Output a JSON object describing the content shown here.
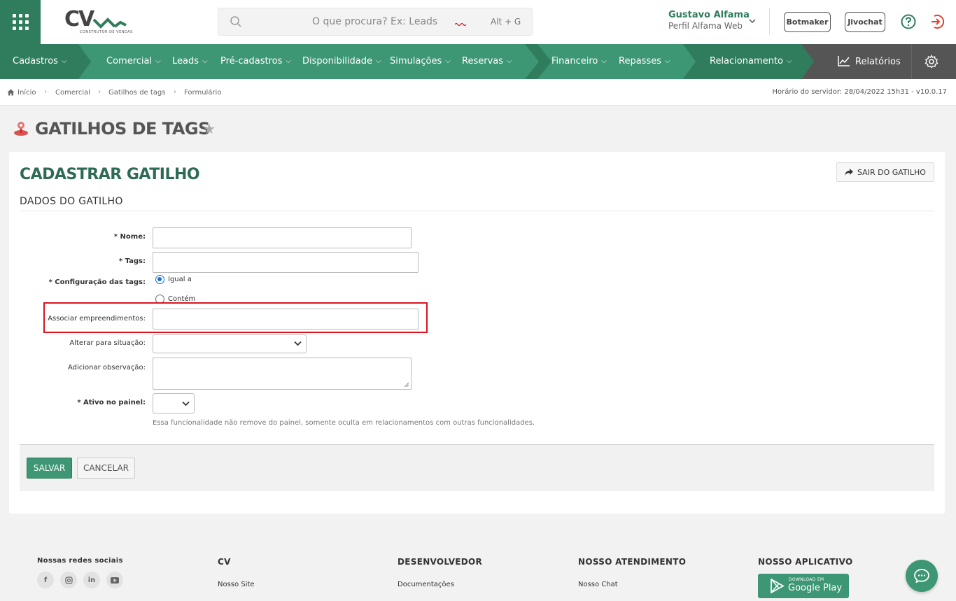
{
  "header": {
    "search_placeholder": "O que procura? Ex: Leads",
    "search_shortcut": "Alt + G",
    "user_name": "Gustavo Alfama",
    "user_profile": "Perfil Alfama Web",
    "botmaker_label": "Botmaker",
    "jivochat_label": "Jivochat",
    "logo_text": "CV",
    "logo_sub": "CONSTRUTOR DE VENDAS"
  },
  "nav": {
    "items": [
      "Cadastros",
      "Comercial",
      "Leads",
      "Pré-cadastros",
      "Disponibilidade",
      "Simulações",
      "Reservas",
      "Financeiro",
      "Repasses",
      "Relacionamento"
    ],
    "reports_label": "Relatórios"
  },
  "breadcrumb": {
    "items": [
      "Início",
      "Comercial",
      "Gatilhos de tags",
      "Formulário"
    ],
    "server_time": "Horário do servidor: 28/04/2022 15h31 - v10.0.17"
  },
  "page": {
    "title": "GATILHOS DE TAGS"
  },
  "form": {
    "title": "CADASTRAR GATILHO",
    "exit_label": "SAIR DO GATILHO",
    "section_title": "DADOS DO GATILHO",
    "name_label": "* Nome:",
    "tags_label": "* Tags:",
    "tags_config_label": "* Configuração das tags:",
    "radio_equal": "Igual a",
    "radio_contains": "Contém",
    "enterprises_label": "Associar empreendimentos:",
    "change_status_label": "Alterar para situação:",
    "observation_label": "Adicionar observação:",
    "active_label": "* Ativo no painel:",
    "active_hint": "Essa funcionalidade não remove do painel, somente oculta em relacionamentos com outras funcionalidades.",
    "save_label": "SALVAR",
    "cancel_label": "CANCELAR"
  },
  "footer": {
    "social_title": "Nossas redes sociais",
    "cv_title": "CV",
    "cv_link": "Nosso Site",
    "dev_title": "DESENVOLVEDOR",
    "dev_link": "Documentações",
    "support_title": "NOSSO ATENDIMENTO",
    "support_link": "Nosso Chat",
    "app_title": "NOSSO APLICATIVO",
    "gplay_small": "DOWNLOAD EM",
    "gplay_big": "Google Play"
  },
  "colors": {
    "brand_green": "#3d9674",
    "dark_green": "#2f7d5c",
    "highlight_red": "#d9141e"
  }
}
